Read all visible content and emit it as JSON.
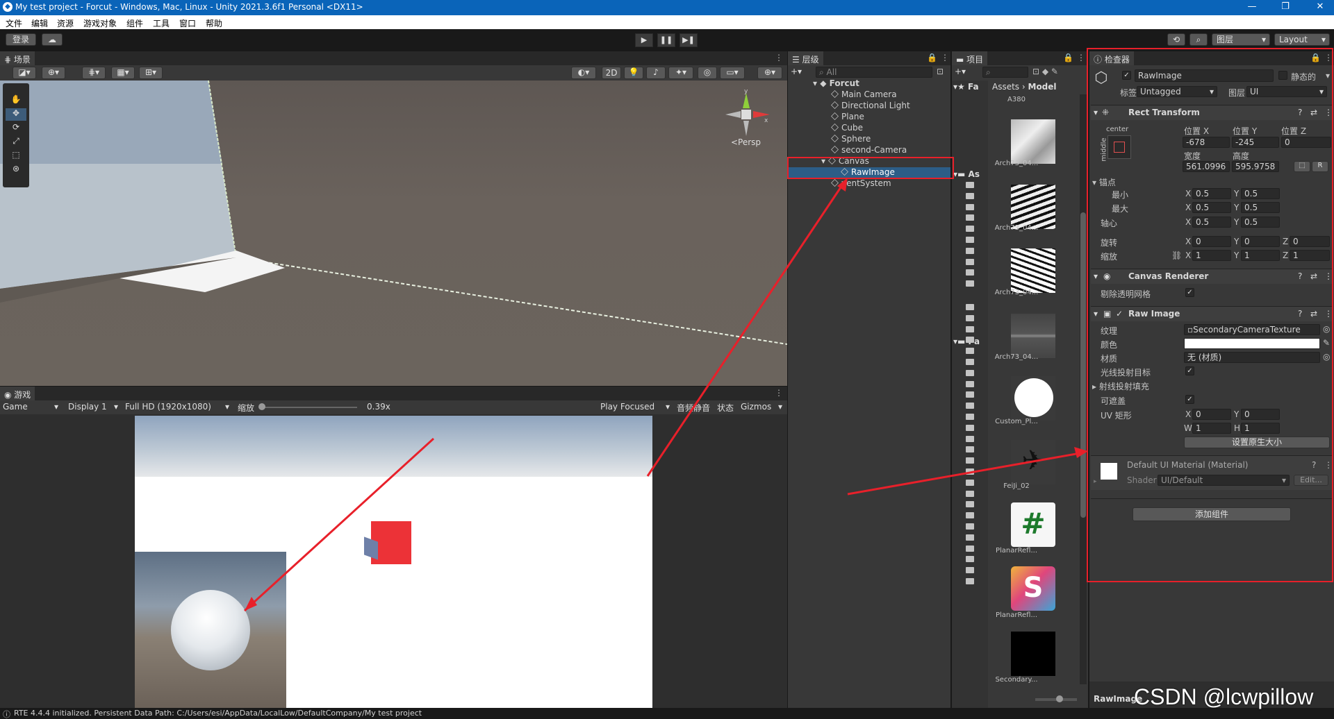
{
  "window": {
    "title": "My test project - Forcut - Windows, Mac, Linux - Unity 2021.3.6f1 Personal <DX11>",
    "controls": [
      "—",
      "❐",
      "✕"
    ]
  },
  "menu": [
    "文件",
    "编辑",
    "资源",
    "游戏对象",
    "组件",
    "工具",
    "窗口",
    "帮助"
  ],
  "toolbar": {
    "login_label": "登录",
    "play_icons": [
      "▶",
      "❚❚",
      "▶❚"
    ],
    "layers_label": "图层",
    "layout_label": "Layout"
  },
  "scene": {
    "tab_label": "场景",
    "mode_2d": "2D",
    "persp_label": "<Persp",
    "gizmo_axes": [
      "y",
      "x"
    ]
  },
  "game": {
    "tab_label": "游戏",
    "view_select": "Game",
    "display_select": "Display 1",
    "resolution_select": "Full HD (1920x1080)",
    "scale_label": "缩放",
    "scale_value": "0.39x",
    "play_focused": "Play Focused",
    "mute": "音频静音",
    "stats": "状态",
    "gizmos": "Gizmos"
  },
  "hierarchy": {
    "tab_label": "层级",
    "search_placeholder": "All",
    "scene_name": "Forcut",
    "items": [
      "Main Camera",
      "Directional Light",
      "Plane",
      "Cube",
      "Sphere",
      "second-Camera",
      "Canvas",
      "RawImage",
      "EventSystem"
    ],
    "eventsystem_visible": "ventSystem"
  },
  "project": {
    "tab_label": "项目",
    "breadcrumb": [
      "Assets",
      "Model"
    ],
    "fav_label": "Fa",
    "assets_label": "As",
    "packages_label": "Pa",
    "top_item": "A380",
    "items": [
      "Arch73_04...",
      "Arch73_04...",
      "Arch73_04...",
      "Arch73_04...",
      "Custom_Pl...",
      "FeiJi_02",
      "PlanarRefl...",
      "PlanarRefl...",
      "Secondary..."
    ]
  },
  "inspector": {
    "tab_label": "检查器",
    "object_name": "RawImage",
    "static_label": "静态的",
    "tag_label": "标签",
    "tag_value": "Untagged",
    "layer_label": "图层",
    "layer_value": "UI",
    "rect_transform": {
      "title": "Rect Transform",
      "anchor_h": "center",
      "anchor_v": "middle",
      "pos_x_label": "位置 X",
      "pos_x": "-678",
      "pos_y_label": "位置 Y",
      "pos_y": "-245",
      "pos_z_label": "位置 Z",
      "pos_z": "0",
      "width_label": "宽度",
      "width": "561.0996",
      "height_label": "高度",
      "height": "595.9758",
      "r_button": "R",
      "anchors_label": "锚点",
      "min_label": "最小",
      "min_x": "0.5",
      "min_y": "0.5",
      "max_label": "最大",
      "max_x": "0.5",
      "max_y": "0.5",
      "pivot_label": "轴心",
      "pivot_x": "0.5",
      "pivot_y": "0.5",
      "rotation_label": "旋转",
      "rot_x": "0",
      "rot_y": "0",
      "rot_z": "0",
      "scale_label": "缩放",
      "scale_x": "1",
      "scale_y": "1",
      "scale_z": "1"
    },
    "canvas_renderer": {
      "title": "Canvas Renderer",
      "cull_label": "剔除透明网格"
    },
    "raw_image": {
      "title": "Raw Image",
      "texture_label": "纹理",
      "texture_value": "SecondaryCameraTexture",
      "color_label": "颜色",
      "material_label": "材质",
      "material_value": "无 (材质)",
      "raycast_label": "光线投射目标",
      "raycast_padding_label": "射线投射填充",
      "maskable_label": "可遮盖",
      "uv_label": "UV 矩形",
      "uv_x": "0",
      "uv_y": "0",
      "uv_w": "1",
      "uv_h": "1",
      "native_size_button": "设置原生大小"
    },
    "material": {
      "title": "Default UI Material (Material)",
      "shader_label": "Shader",
      "shader_value": "UI/Default",
      "edit_button": "Edit..."
    },
    "add_component": "添加组件",
    "footer_name": "RawImage"
  },
  "status_bar": "RTE 4.4.4 initialized. Persistent Data Path: C:/Users/esi/AppData/LocalLow/DefaultCompany/My test project",
  "watermark": "CSDN @lcwpillow",
  "colors": {
    "highlight_red": "#e8202a",
    "selection_blue": "#2c5d87",
    "titlebar_blue": "#0a64b9"
  }
}
